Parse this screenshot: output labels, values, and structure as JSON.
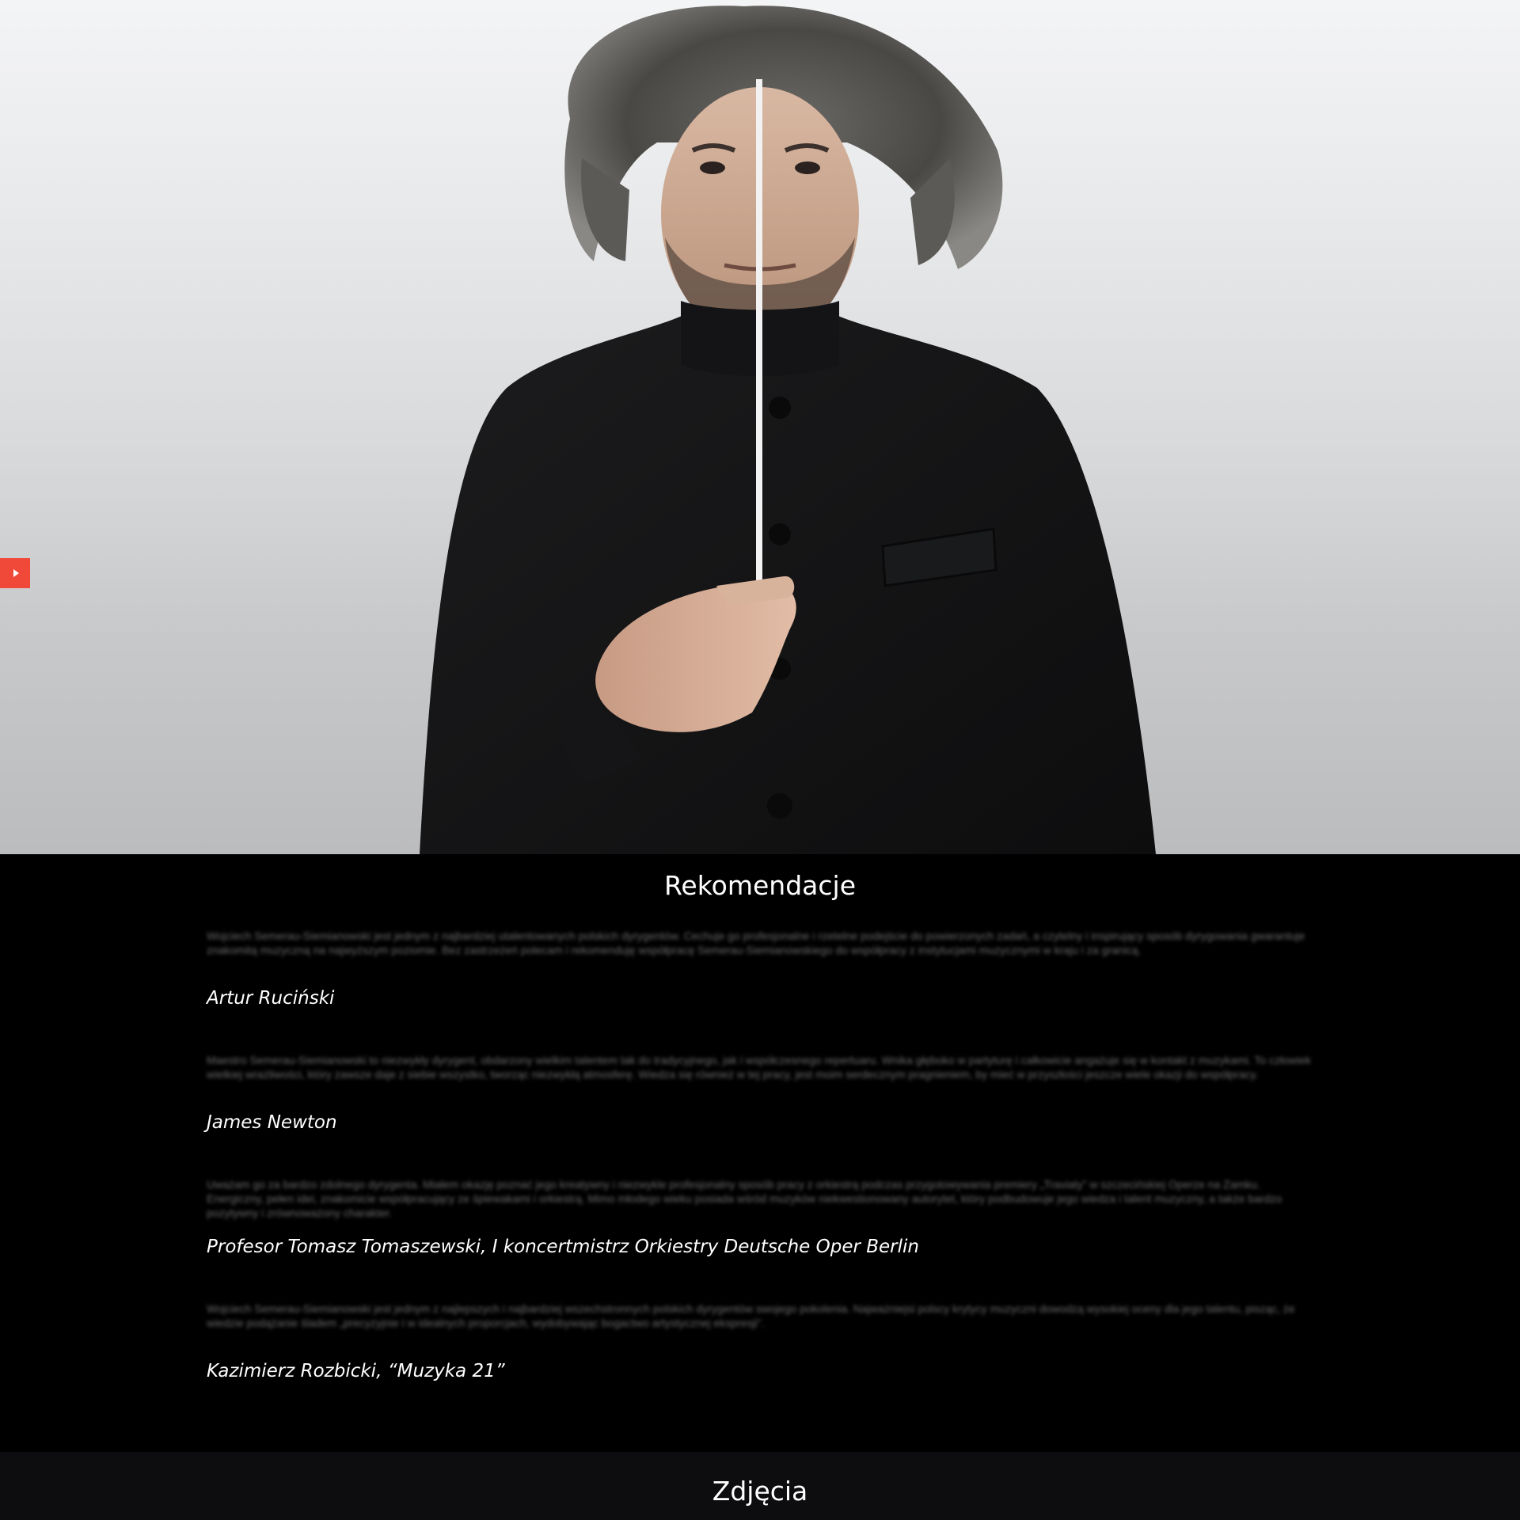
{
  "hero": {
    "photo_icon": "conductor-portrait"
  },
  "side_tabs": [
    {
      "icon": "play-icon"
    },
    {
      "icon": "play-icon"
    }
  ],
  "recommendations": {
    "title": "Rekomendacje",
    "items": [
      {
        "quote": "Wojciech Semerau-Siemianowski jest jednym z najbardziej utalentowanych polskich dyrygentów. Cechuje go profesjonalne i rzetelne podejście do powierzonych zadań, a czytelny i inspirujący sposób dyrygowania gwarantuje znakomitą muzyczną na najwyższym poziomie. Bez zastrzeżeń polecam i rekomenduję współpracę Semerau-Siemianowskiego do współpracy z instytucjami muzycznymi w kraju i za granicą.",
        "author": "Artur Ruciński"
      },
      {
        "quote": "Maestro Semerau-Siemianowski to niezwykły dyrygent, obdarzony wielkim talentem tak do tradycyjnego, jak i współczesnego repertuaru. Wnika głęboko w partyturę i całkowicie angażuje się w kontakt z muzykami. To człowiek wielkiej wrażliwości, który zawsze daje z siebie wszystko, tworząc niezwykłą atmosferę. Wiedza się również w tej pracy, jest moim serdecznym pragnieniem, by mieć w przyszłości jeszcze wiele okazji do współpracy.",
        "author": "James Newton"
      },
      {
        "quote": "Uważam go za bardzo zdolnego dyrygenta. Miałem okazję poznać jego kreatywny i niezwykle profesjonalny sposób pracy z orkiestrą podczas przygotowywania premiery „Traviaty” w szczecińskiej Operze na Zamku. Energiczny, pełen idei, znakomicie współpracujący ze śpiewakami i orkiestrą. Mimo młodego wieku posiada wśród muzyków niekwestionowany autorytet, który podbudowuje jego wiedza i talent muzyczny, a także bardzo pozytywny i zrównoważony charakter.",
        "author": "Profesor Tomasz Tomaszewski, I koncertmistrz Orkiestry Deutsche Oper Berlin"
      },
      {
        "quote": "Wojciech Semerau-Siemianowski jest jednym z najlepszych i najbardziej wszechstronnych polskich dyrygentów swojego pokolenia. Najważniejsi polscy krytycy muzyczni dowodzą wysokiej oceny dla jego talentu, pisząc, że wiedzie podążanie śladem „precyzyjnie i w idealnych proporcjach, wydobywając bogactwo artystycznej ekspresji”.",
        "author": "Kazimierz Rozbicki, “Muzyka 21”"
      }
    ]
  },
  "photos_section": {
    "title": "Zdjęcia"
  }
}
